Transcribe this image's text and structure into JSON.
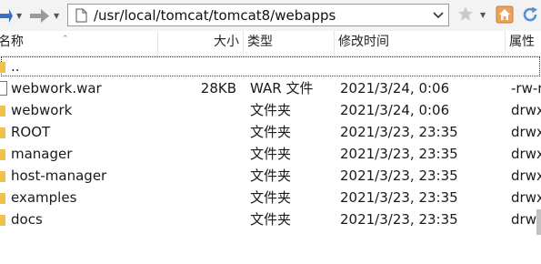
{
  "toolbar": {
    "back_icon": "back-arrow-icon",
    "forward_icon": "forward-arrow-icon",
    "path": "/usr/local/tomcat/tomcat8/webapps",
    "bookmark_icon": "star-icon",
    "home_icon": "home-icon",
    "refresh_icon": "refresh-icon"
  },
  "columns": {
    "name": "名称",
    "size": "大小",
    "type": "类型",
    "modified": "修改时间",
    "attributes": "属性"
  },
  "rows": [
    {
      "name": "..",
      "size": "",
      "type": "",
      "modified": "",
      "attributes": "",
      "icon": "folder-up-icon"
    },
    {
      "name": "webwork.war",
      "size": "28KB",
      "type": "WAR 文件",
      "modified": "2021/3/24, 0:06",
      "attributes": "-rw-r",
      "icon": "file-icon"
    },
    {
      "name": "webwork",
      "size": "",
      "type": "文件夹",
      "modified": "2021/3/24, 0:06",
      "attributes": "drwx",
      "icon": "folder-icon"
    },
    {
      "name": "ROOT",
      "size": "",
      "type": "文件夹",
      "modified": "2021/3/23, 23:35",
      "attributes": "drwx",
      "icon": "folder-icon"
    },
    {
      "name": "manager",
      "size": "",
      "type": "文件夹",
      "modified": "2021/3/23, 23:35",
      "attributes": "drwx",
      "icon": "folder-icon"
    },
    {
      "name": "host-manager",
      "size": "",
      "type": "文件夹",
      "modified": "2021/3/23, 23:35",
      "attributes": "drwx",
      "icon": "folder-icon"
    },
    {
      "name": "examples",
      "size": "",
      "type": "文件夹",
      "modified": "2021/3/23, 23:35",
      "attributes": "drwx",
      "icon": "folder-icon"
    },
    {
      "name": "docs",
      "size": "",
      "type": "文件夹",
      "modified": "2021/3/23, 23:35",
      "attributes": "drwx",
      "icon": "folder-icon"
    }
  ],
  "colors": {
    "folder": "#f0c24a",
    "arrow": "#3a6fc4",
    "home": "#e0894a",
    "refresh": "#5a8fd6"
  }
}
